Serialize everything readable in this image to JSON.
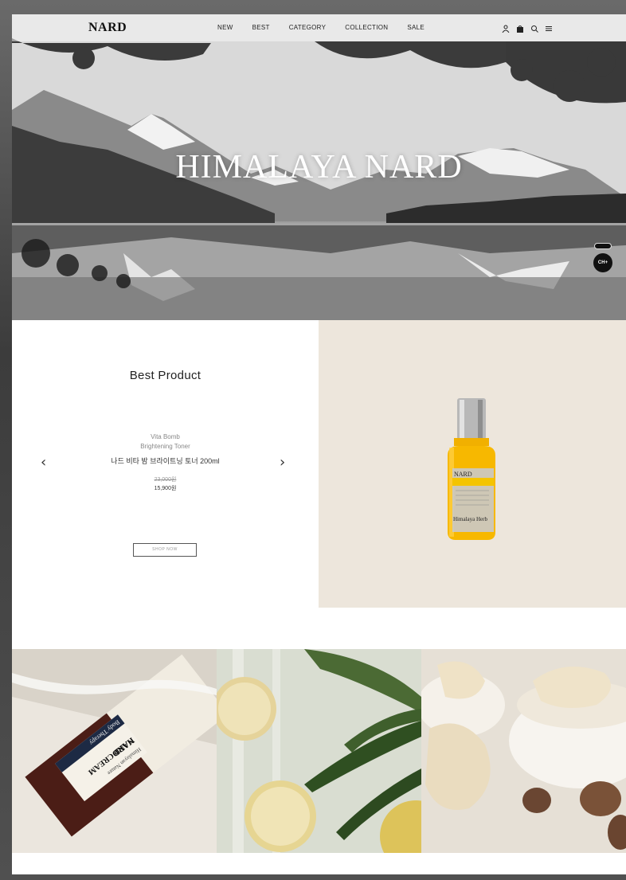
{
  "nav": {
    "logo": "NARD",
    "links": [
      "NEW",
      "BEST",
      "CATEGORY",
      "COLLECTION",
      "SALE"
    ],
    "icons": [
      "user-icon",
      "bag-icon",
      "search-icon",
      "menu-icon"
    ]
  },
  "hero": {
    "title": "HIMALAYA NARD"
  },
  "chat": {
    "label": "CH+"
  },
  "best": {
    "title": "Best Product",
    "product_en_1": "Vita Bomb",
    "product_en_2": "Brightening Toner",
    "product_ko": "나드 비타 밤 브라이트닝 토너 200ml",
    "price_old": "23,000원",
    "price_new": "15,900원",
    "prev": "‹",
    "next": "›",
    "shop_now": "SHOP NOW"
  },
  "bottle": {
    "brand": "NARD",
    "line": "Himalaya Herb"
  },
  "strip": {
    "tube_text_1": "NARD",
    "tube_text_2": "HAND CREAM",
    "tube_text_3": "Body Therapy",
    "tube_text_4": "Himalayan Nature"
  }
}
